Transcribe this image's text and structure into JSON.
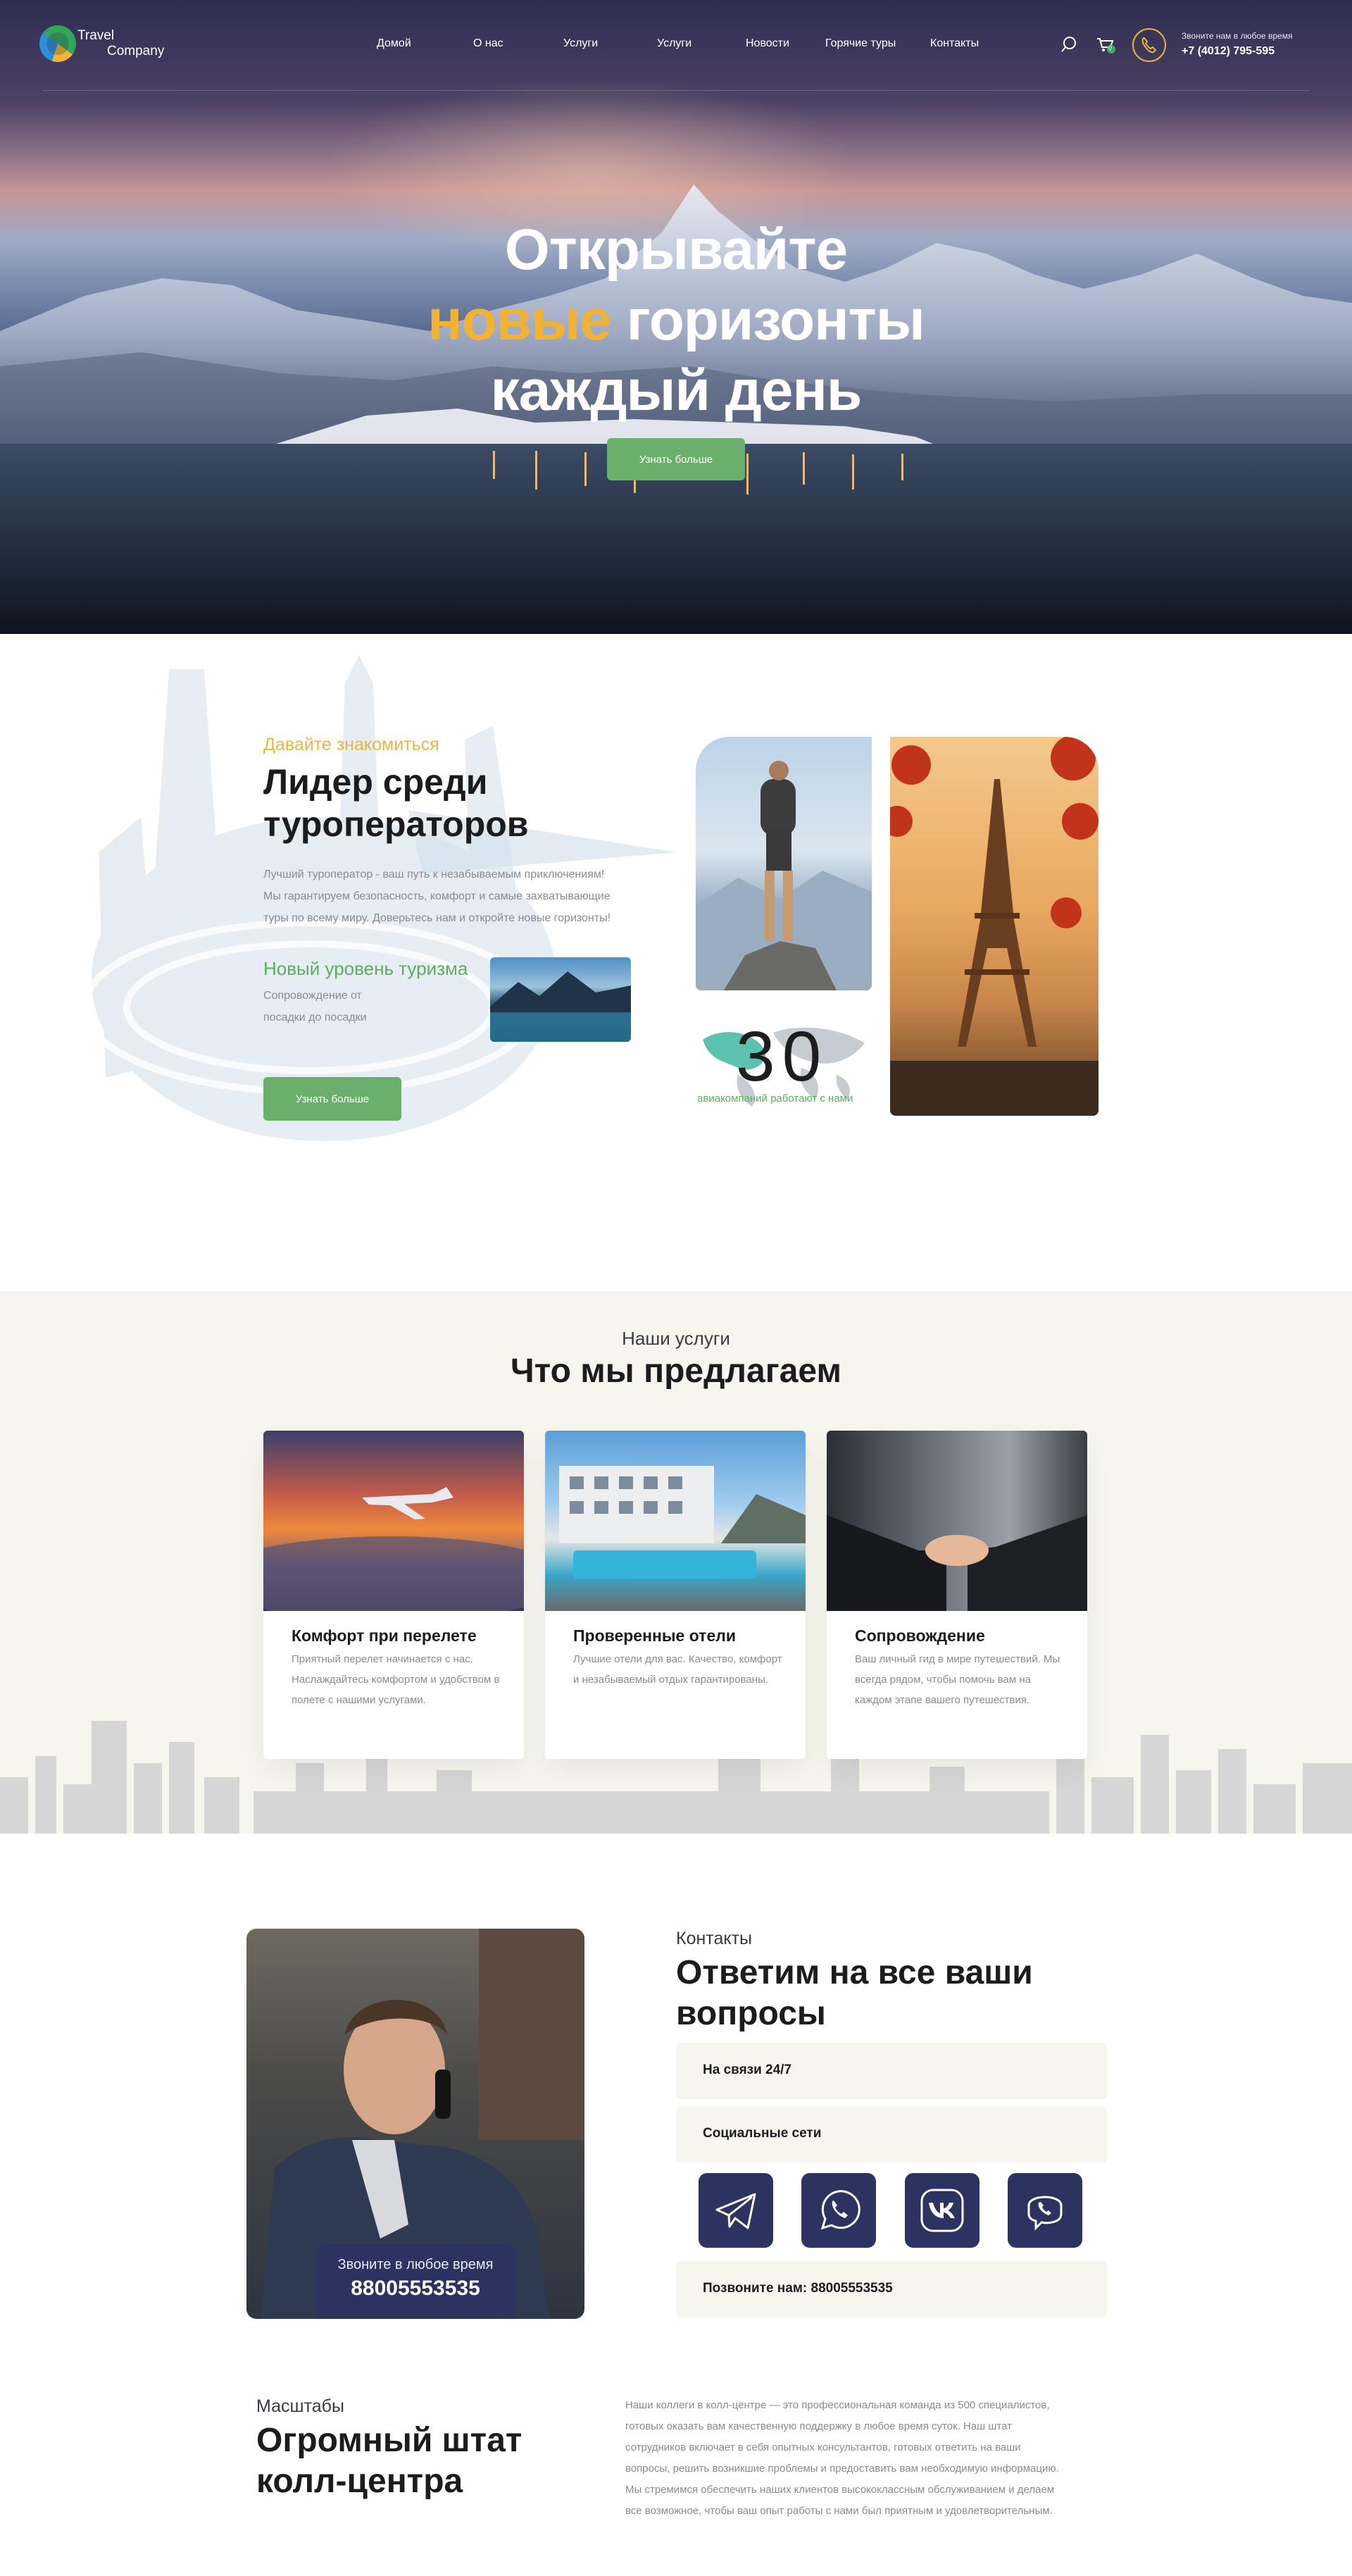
{
  "header": {
    "logo_line1": "Travel",
    "logo_line2": "Company",
    "nav": [
      "Домой",
      "О нас",
      "Услуги",
      "Услуги",
      "Новости",
      "Горячие туры",
      "Контакты"
    ],
    "cart_count": "0",
    "call_hint": "Звоните нам в любое время",
    "phone": "+7 (4012) 795-595"
  },
  "hero": {
    "line1": "Открывайте",
    "line2_accent": "новые",
    "line2_rest": " горизонты",
    "line3": "каждый день",
    "button": "Узнать больше"
  },
  "about": {
    "kicker": "Давайте  знакомиться",
    "title_line1": "Лидер среди",
    "title_line2": "туроператоров",
    "paragraph": [
      "Лучший туроператор - ваш путь к незабываемым приключениям!",
      "Мы гарантируем безопасность, комфорт и самые захватывающие",
      "туры по всему миру. Доверьтесь нам и откройте новые горизонты!"
    ],
    "sub_title": "Новый уровень туризма",
    "sub_text": [
      "Сопровождение от",
      "посадки до посадки"
    ],
    "button": "Узнать больше",
    "stat_number": "30",
    "stat_label": "авиакомпаний работают с нами"
  },
  "services": {
    "kicker": "Наши  услуги",
    "title": "Что мы предлагаем",
    "cards": [
      {
        "title": "Комфорт при перелете",
        "text": "Приятный перелет начинается с нас. Наслаждайтесь комфортом и удобством в полете с нашими услугами."
      },
      {
        "title": "Проверенные отели",
        "text": "Лучшие отели для вас. Качество, комфорт и незабываемый отдых гарантированы."
      },
      {
        "title": "Сопровождение",
        "text": "Ваш личный гид в мире путешествий. Мы всегда рядом, чтобы помочь вам на каждом этапе вашего путешествия."
      }
    ]
  },
  "contacts": {
    "photo_caption": "Звоните в любое время",
    "photo_phone": "88005553535",
    "kicker": "Контакты",
    "title_line1": "Ответим на все ваши",
    "title_line2": "вопросы",
    "row1": "На связи 24/7",
    "row2": "Социальные сети",
    "row3": "Позвоните нам: 88005553535",
    "socials": [
      "telegram-icon",
      "whatsapp-icon",
      "vk-icon",
      "viber-icon"
    ]
  },
  "scale": {
    "kicker": "Масштабы",
    "title_line1": "Огромный штат",
    "title_line2": "колл-центра",
    "paragraph": [
      "Наши коллеги в колл-центре — это профессиональная команда из 500 специалистов,",
      "готовых оказать вам качественную поддержку в любое время суток. Наш штат",
      "сотрудников включает в себя опытных консультантов, готовых ответить на ваши",
      "вопросы, решить возникшие проблемы и предоставить вам необходимую информацию.",
      "Мы стремимся обеспечить наших клиентов высококлассным обслуживанием и делаем",
      "все возможное, чтобы ваш опыт работы с нами был приятным и удовлетворительным."
    ]
  },
  "colors": {
    "accent_yellow": "#f2b233",
    "green": "#6aaf6a",
    "navy": "#2c3360",
    "cream": "#f7f6ee"
  }
}
